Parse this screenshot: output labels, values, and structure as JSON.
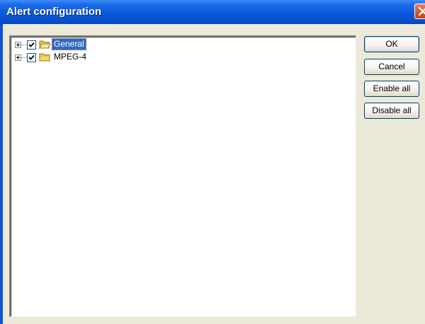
{
  "window": {
    "title": "Alert configuration"
  },
  "tree": {
    "nodes": [
      {
        "label": "General",
        "checked": true,
        "selected": true,
        "folder": "open-folder-icon"
      },
      {
        "label": "MPEG-4",
        "checked": true,
        "selected": false,
        "folder": "folder-icon"
      }
    ]
  },
  "buttons": {
    "ok": "OK",
    "cancel": "Cancel",
    "enable_all": "Enable all",
    "disable_all": "Disable all"
  },
  "colors": {
    "title_bar": "#0a53d8",
    "dialog_bg": "#ece9d8",
    "selection": "#316ac5",
    "close_button": "#d65a37"
  }
}
